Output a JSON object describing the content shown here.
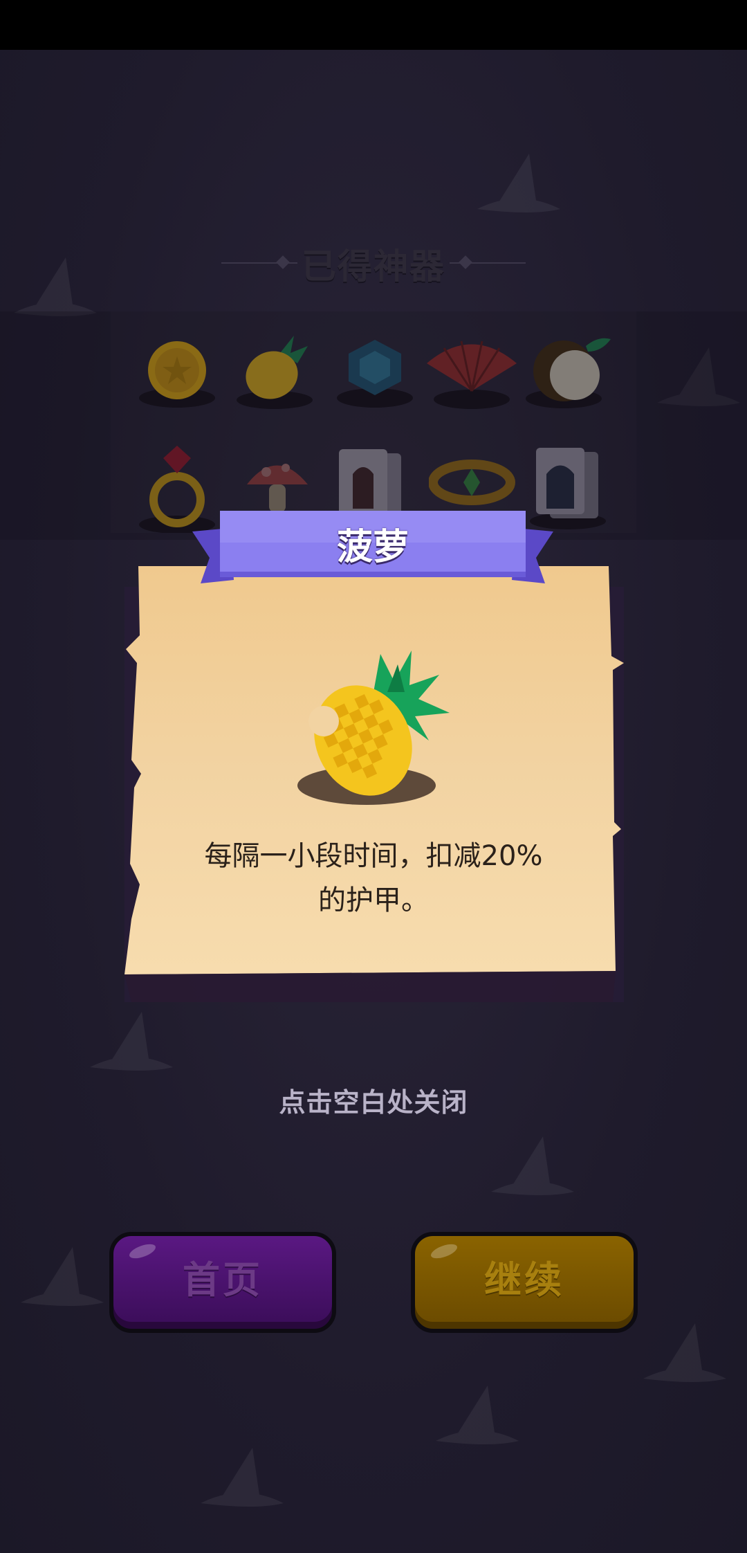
{
  "header": {
    "title": "已得神器"
  },
  "artifacts": [
    {
      "name": "gold-coin-icon"
    },
    {
      "name": "pineapple-icon"
    },
    {
      "name": "sapphire-gem-icon"
    },
    {
      "name": "folding-fan-icon"
    },
    {
      "name": "coconut-icon"
    },
    {
      "name": "ruby-ring-icon"
    },
    {
      "name": "mushroom-icon"
    },
    {
      "name": "playing-card-jack-icon"
    },
    {
      "name": "emerald-bracelet-icon"
    },
    {
      "name": "playing-card-queen-icon"
    }
  ],
  "popup": {
    "title": "菠萝",
    "description_line1": "每隔一小段时间，扣减20%",
    "description_line2": "的护甲。",
    "icon": "pineapple-icon"
  },
  "hint": "点击空白处关闭",
  "buttons": {
    "home": "首页",
    "continue": "继续"
  },
  "colors": {
    "ribbon": "#8b7ff0",
    "parchment": "#f2cf9a",
    "home_button": "#4a1270",
    "continue_button": "#7a5600"
  }
}
